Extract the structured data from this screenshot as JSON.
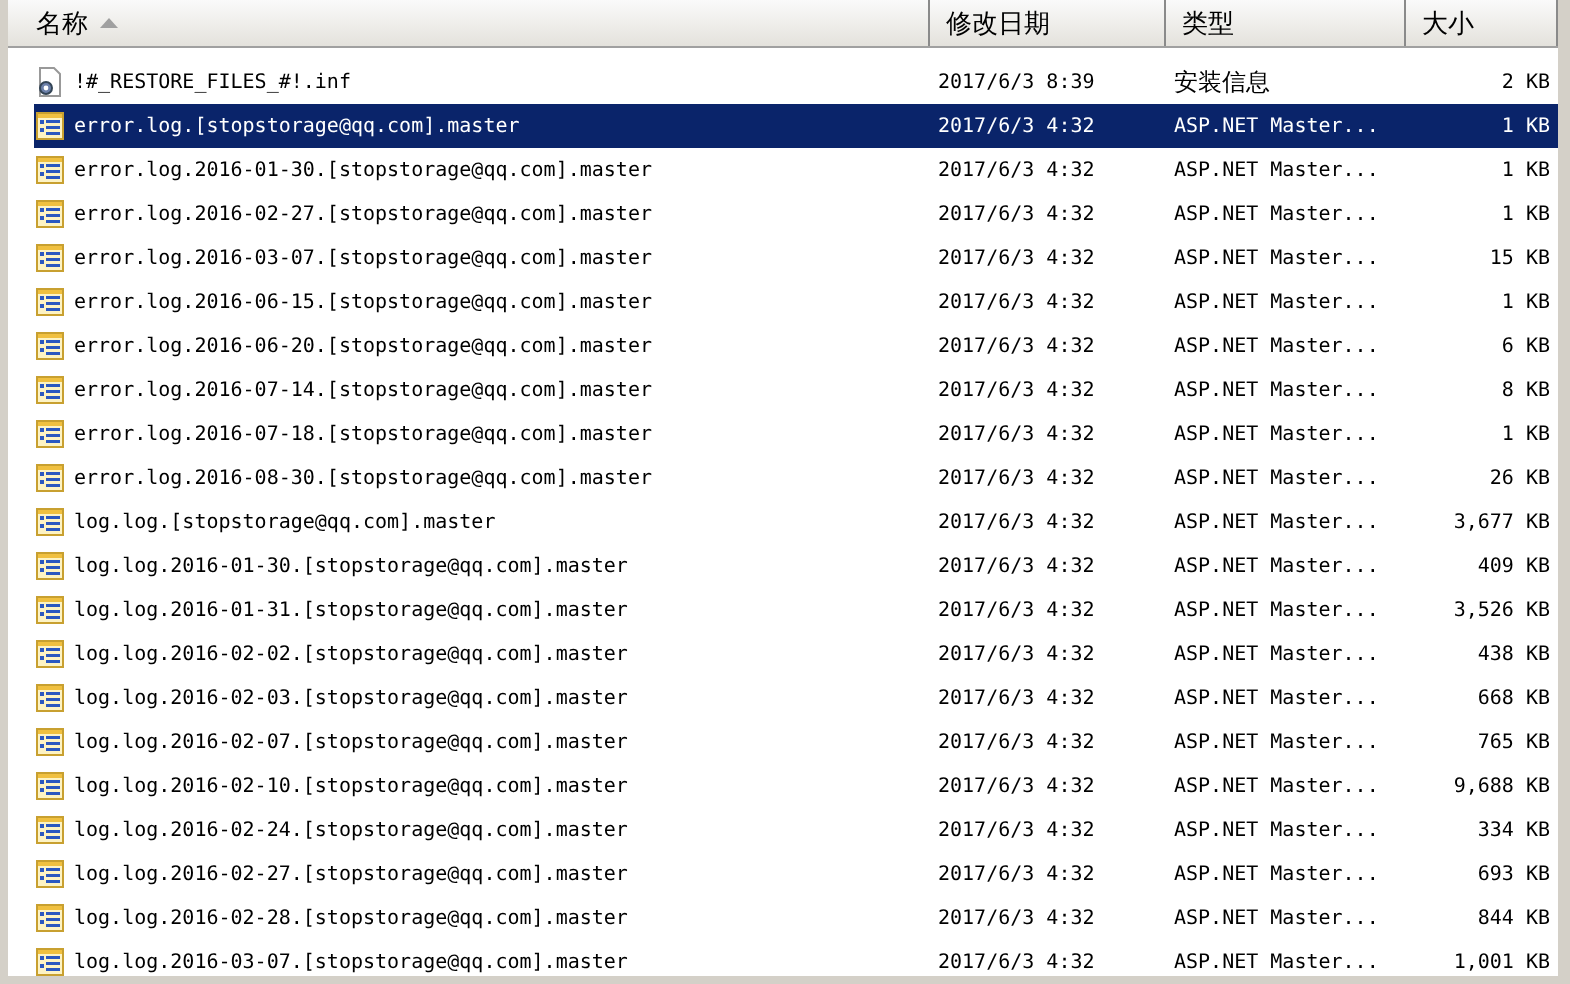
{
  "columns": [
    {
      "label": "名称",
      "sorted": true
    },
    {
      "label": "修改日期",
      "sorted": false
    },
    {
      "label": "类型",
      "sorted": false
    },
    {
      "label": "大小",
      "sorted": false
    }
  ],
  "rows": [
    {
      "kind": "settings",
      "name": "!#_RESTORE_FILES_#!.inf",
      "modified": "2017/6/3 8:39",
      "type": "安装信息",
      "size": "2 KB",
      "selected": false
    },
    {
      "kind": "document",
      "name": "error.log.[stopstorage@qq.com].master",
      "modified": "2017/6/3 4:32",
      "type": "ASP.NET Master...",
      "size": "1 KB",
      "selected": true
    },
    {
      "kind": "document",
      "name": "error.log.2016-01-30.[stopstorage@qq.com].master",
      "modified": "2017/6/3 4:32",
      "type": "ASP.NET Master...",
      "size": "1 KB",
      "selected": false
    },
    {
      "kind": "document",
      "name": "error.log.2016-02-27.[stopstorage@qq.com].master",
      "modified": "2017/6/3 4:32",
      "type": "ASP.NET Master...",
      "size": "1 KB",
      "selected": false
    },
    {
      "kind": "document",
      "name": "error.log.2016-03-07.[stopstorage@qq.com].master",
      "modified": "2017/6/3 4:32",
      "type": "ASP.NET Master...",
      "size": "15 KB",
      "selected": false
    },
    {
      "kind": "document",
      "name": "error.log.2016-06-15.[stopstorage@qq.com].master",
      "modified": "2017/6/3 4:32",
      "type": "ASP.NET Master...",
      "size": "1 KB",
      "selected": false
    },
    {
      "kind": "document",
      "name": "error.log.2016-06-20.[stopstorage@qq.com].master",
      "modified": "2017/6/3 4:32",
      "type": "ASP.NET Master...",
      "size": "6 KB",
      "selected": false
    },
    {
      "kind": "document",
      "name": "error.log.2016-07-14.[stopstorage@qq.com].master",
      "modified": "2017/6/3 4:32",
      "type": "ASP.NET Master...",
      "size": "8 KB",
      "selected": false
    },
    {
      "kind": "document",
      "name": "error.log.2016-07-18.[stopstorage@qq.com].master",
      "modified": "2017/6/3 4:32",
      "type": "ASP.NET Master...",
      "size": "1 KB",
      "selected": false
    },
    {
      "kind": "document",
      "name": "error.log.2016-08-30.[stopstorage@qq.com].master",
      "modified": "2017/6/3 4:32",
      "type": "ASP.NET Master...",
      "size": "26 KB",
      "selected": false
    },
    {
      "kind": "document",
      "name": "log.log.[stopstorage@qq.com].master",
      "modified": "2017/6/3 4:32",
      "type": "ASP.NET Master...",
      "size": "3,677 KB",
      "selected": false
    },
    {
      "kind": "document",
      "name": "log.log.2016-01-30.[stopstorage@qq.com].master",
      "modified": "2017/6/3 4:32",
      "type": "ASP.NET Master...",
      "size": "409 KB",
      "selected": false
    },
    {
      "kind": "document",
      "name": "log.log.2016-01-31.[stopstorage@qq.com].master",
      "modified": "2017/6/3 4:32",
      "type": "ASP.NET Master...",
      "size": "3,526 KB",
      "selected": false
    },
    {
      "kind": "document",
      "name": "log.log.2016-02-02.[stopstorage@qq.com].master",
      "modified": "2017/6/3 4:32",
      "type": "ASP.NET Master...",
      "size": "438 KB",
      "selected": false
    },
    {
      "kind": "document",
      "name": "log.log.2016-02-03.[stopstorage@qq.com].master",
      "modified": "2017/6/3 4:32",
      "type": "ASP.NET Master...",
      "size": "668 KB",
      "selected": false
    },
    {
      "kind": "document",
      "name": "log.log.2016-02-07.[stopstorage@qq.com].master",
      "modified": "2017/6/3 4:32",
      "type": "ASP.NET Master...",
      "size": "765 KB",
      "selected": false
    },
    {
      "kind": "document",
      "name": "log.log.2016-02-10.[stopstorage@qq.com].master",
      "modified": "2017/6/3 4:32",
      "type": "ASP.NET Master...",
      "size": "9,688 KB",
      "selected": false
    },
    {
      "kind": "document",
      "name": "log.log.2016-02-24.[stopstorage@qq.com].master",
      "modified": "2017/6/3 4:32",
      "type": "ASP.NET Master...",
      "size": "334 KB",
      "selected": false
    },
    {
      "kind": "document",
      "name": "log.log.2016-02-27.[stopstorage@qq.com].master",
      "modified": "2017/6/3 4:32",
      "type": "ASP.NET Master...",
      "size": "693 KB",
      "selected": false
    },
    {
      "kind": "document",
      "name": "log.log.2016-02-28.[stopstorage@qq.com].master",
      "modified": "2017/6/3 4:32",
      "type": "ASP.NET Master...",
      "size": "844 KB",
      "selected": false
    },
    {
      "kind": "document",
      "name": "log.log.2016-03-07.[stopstorage@qq.com].master",
      "modified": "2017/6/3 4:32",
      "type": "ASP.NET Master...",
      "size": "1,001 KB",
      "selected": false
    }
  ]
}
